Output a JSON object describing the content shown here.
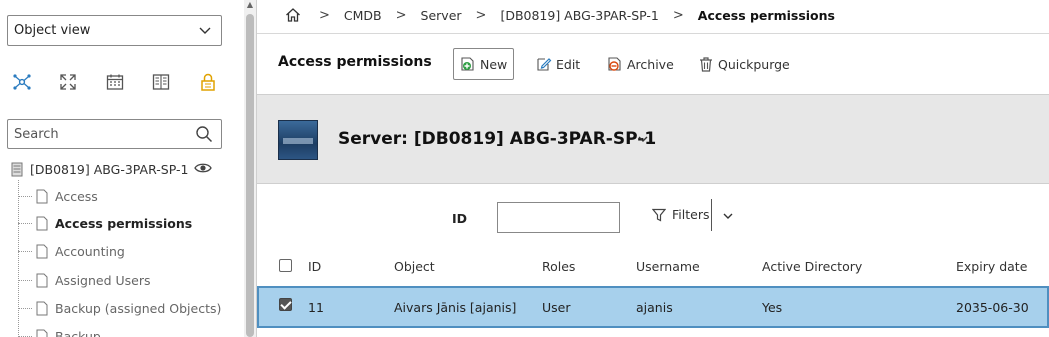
{
  "sidebar": {
    "view_select": "Object view",
    "tool_icons": [
      "network-icon",
      "expand-icon",
      "calendar-icon",
      "book-icon",
      "lock-icon"
    ],
    "search_placeholder": "Search",
    "tree": {
      "root_label": "[DB0819] ABG-3PAR-SP-1",
      "items": [
        {
          "label": "Access"
        },
        {
          "label": "Access permissions",
          "active": true
        },
        {
          "label": "Accounting"
        },
        {
          "label": "Assigned Users"
        },
        {
          "label": "Backup (assigned Objects)"
        },
        {
          "label": "Backup"
        }
      ]
    }
  },
  "breadcrumb": {
    "items": [
      "CMDB",
      "Server",
      "[DB0819] ABG-3PAR-SP-1"
    ],
    "current": "Access permissions"
  },
  "toolbar": {
    "title": "Access permissions",
    "new_label": "New",
    "edit_label": "Edit",
    "archive_label": "Archive",
    "quickpurge_label": "Quickpurge"
  },
  "object_header": {
    "title": "Server: [DB0819] ABG-3PAR-SP-1"
  },
  "filter": {
    "id_label": "ID",
    "id_value": "",
    "filters_label": "Filters"
  },
  "table": {
    "columns": [
      "ID",
      "Object",
      "Roles",
      "Username",
      "Active Directory",
      "Expiry date"
    ],
    "rows": [
      {
        "selected": true,
        "id": "11",
        "object": "Aivars Jānis [ajanis]",
        "roles": "User",
        "username": "ajanis",
        "active_directory": "Yes",
        "expiry_date": "2035-06-30"
      }
    ]
  },
  "colors": {
    "selected_row_bg": "#a7d0ec",
    "selected_row_border": "#4f8fc0",
    "header_band_bg": "#e7e7e7",
    "icon_accent": "#2a7bbf",
    "lock_icon": "#e0a200"
  }
}
